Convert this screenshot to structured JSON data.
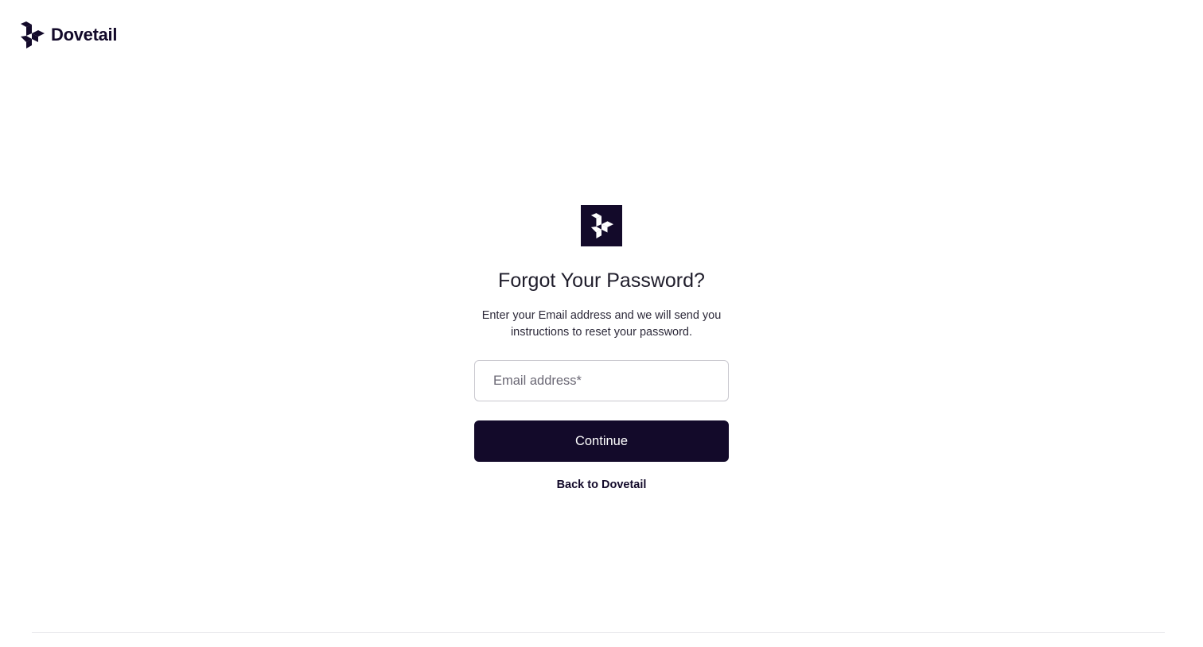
{
  "header": {
    "brand_name": "Dovetail",
    "logo_icon": "dovetail-logo-icon"
  },
  "main": {
    "badge_icon": "dovetail-logo-icon",
    "title": "Forgot Your Password?",
    "description": "Enter your Email address and we will send you instructions to reset your password.",
    "email": {
      "placeholder": "Email address*",
      "value": ""
    },
    "continue_label": "Continue",
    "back_link_label": "Back to Dovetail"
  },
  "colors": {
    "brand_dark": "#130a2a",
    "background": "#ffffff",
    "input_border": "#c9c8cf"
  }
}
